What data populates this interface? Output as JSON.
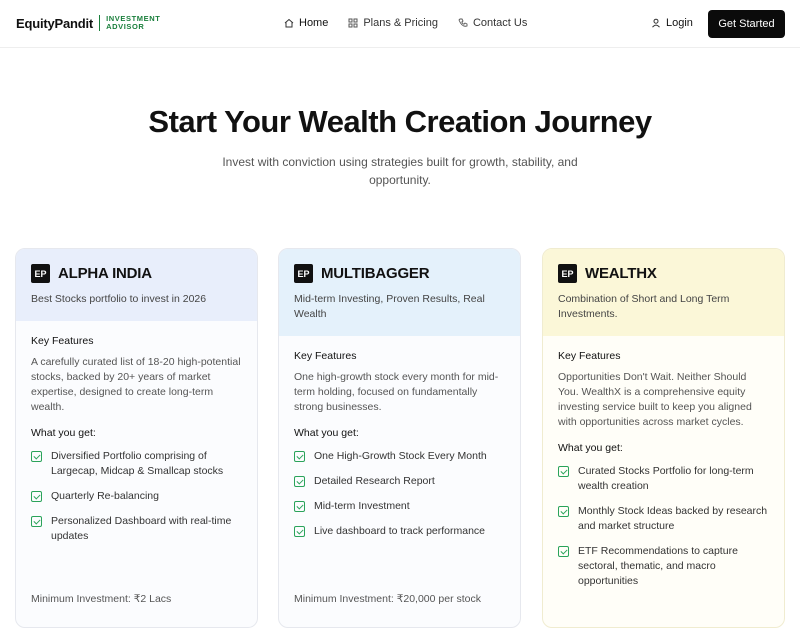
{
  "nav": {
    "brand": "EquityPandit",
    "brand_sub_1": "INVESTMENT",
    "brand_sub_2": "ADVISOR",
    "links": [
      {
        "label": "Home",
        "icon": "home-icon"
      },
      {
        "label": "Plans & Pricing",
        "icon": "grid-icon"
      },
      {
        "label": "Contact Us",
        "icon": "phone-icon"
      }
    ],
    "login": "Login",
    "cta": "Get Started"
  },
  "hero": {
    "title": "Start Your Wealth Creation Journey",
    "subtitle": "Invest with conviction using strategies built for growth, stability, and opportunity."
  },
  "cards": [
    {
      "badge": "EP",
      "title": "ALPHA INDIA",
      "tagline": "Best Stocks portfolio to invest in 2026",
      "key_features_label": "Key Features",
      "description": "A carefully curated list of 18-20 high-potential stocks, backed by 20+ years of market expertise, designed to create long-term wealth.",
      "what_you_get_label": "What you get:",
      "items": [
        "Diversified Portfolio comprising of Largecap, Midcap & Smallcap stocks",
        "Quarterly Re-balancing",
        "Personalized Dashboard with real-time updates"
      ],
      "min_investment": "Minimum Investment: ₹2 Lacs",
      "head_color": "#e8eefb"
    },
    {
      "badge": "EP",
      "title": "MULTIBAGGER",
      "tagline": "Mid-term Investing, Proven Results, Real Wealth",
      "key_features_label": "Key Features",
      "description": "One high-growth stock every month for mid-term holding, focused on fundamentally strong businesses.",
      "what_you_get_label": "What you get:",
      "items": [
        "One High-Growth Stock Every Month",
        "Detailed Research Report",
        "Mid-term Investment",
        "Live dashboard to track performance"
      ],
      "min_investment": "Minimum Investment: ₹20,000 per stock",
      "head_color": "#e4f1fb"
    },
    {
      "badge": "EP",
      "title": "WEALTHX",
      "tagline": "Combination of Short and Long Term Investments.",
      "key_features_label": "Key Features",
      "description": "Opportunities Don't Wait. Neither Should You. WealthX is a comprehensive equity investing service built to keep you aligned with opportunities across market cycles.",
      "what_you_get_label": "What you get:",
      "items": [
        "Curated Stocks Portfolio for long-term wealth creation",
        "Monthly Stock Ideas backed by research and market structure",
        "ETF Recommendations to capture sectoral, thematic, and macro opportunities"
      ],
      "min_investment": "",
      "head_color": "#fbf7d8"
    }
  ],
  "colors": {
    "accent": "#1a7f3c",
    "cta_bg": "#0b0b0b"
  }
}
